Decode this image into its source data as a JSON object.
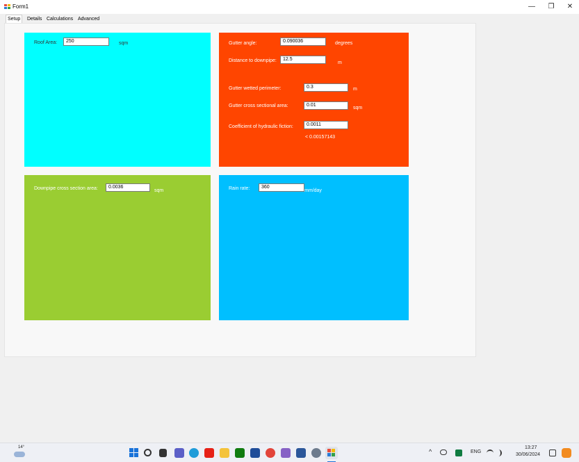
{
  "window": {
    "title": "Form1",
    "minimize_glyph": "—",
    "restore_glyph": "❐",
    "close_glyph": "✕"
  },
  "tabs": [
    {
      "label": "Setup"
    },
    {
      "label": "Details"
    },
    {
      "label": "Calculations"
    },
    {
      "label": "Advanced"
    }
  ],
  "roof": {
    "color": "#00ffff",
    "label": "Roof Area:",
    "value": "250",
    "unit": "sqm"
  },
  "gutter": {
    "color": "#ff4500",
    "angle_label": "Gutter angle:",
    "angle_value": "0.090036",
    "angle_unit": "degrees",
    "distance_label": "Distance to downpipe:",
    "distance_value": "12.5",
    "distance_unit": "m",
    "perimeter_label": "Gutter wetted perimeter:",
    "perimeter_value": "0.3",
    "perimeter_unit": "m",
    "area_label": "Gutter cross sectional area:",
    "area_value": "0.01",
    "area_unit": "sqm",
    "friction_label": "Coefficient of hydraulic fiction:",
    "friction_value": "0.0011",
    "friction_note": "<   0.00157143"
  },
  "downpipe": {
    "color": "#9acd32",
    "label": "Downpipe cross section area:",
    "value": "0.0036",
    "unit": "sqm"
  },
  "rain": {
    "color": "#00bfff",
    "label": "Rain rate:",
    "value": "360",
    "unit": "mm/day"
  },
  "taskbar": {
    "weather": "14°",
    "tray_caret": "^",
    "language": "ENG",
    "time": "13:27",
    "date": "30/06/2024"
  }
}
